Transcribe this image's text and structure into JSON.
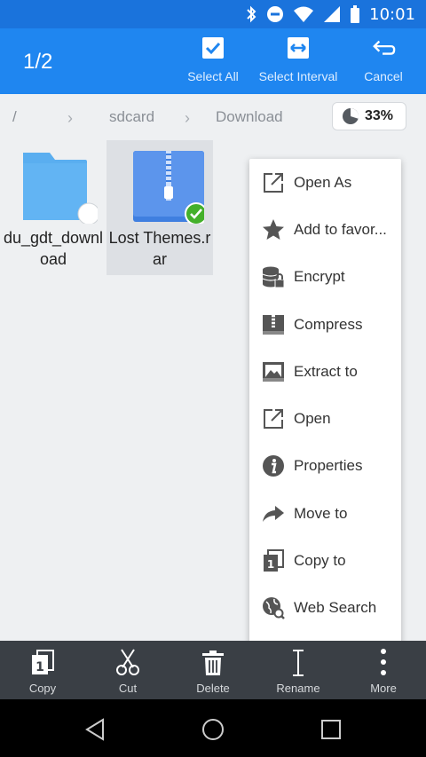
{
  "status_bar": {
    "time": "10:01"
  },
  "toolbar": {
    "selection_count": "1/2",
    "select_all_label": "Select All",
    "select_interval_label": "Select Interval",
    "cancel_label": "Cancel"
  },
  "breadcrumb": {
    "items": [
      "/",
      "sdcard",
      "Download"
    ],
    "storage_percent": "33%"
  },
  "files": [
    {
      "name": "du_gdt_download",
      "type": "folder-icon",
      "selected": false
    },
    {
      "name": "Lost Themes.rar",
      "type": "archive-icon",
      "selected": true
    }
  ],
  "context_menu": {
    "items": [
      {
        "label": "Open As",
        "icon": "open-external-icon"
      },
      {
        "label": "Add to favor...",
        "icon": "star-icon"
      },
      {
        "label": "Encrypt",
        "icon": "lock-database-icon"
      },
      {
        "label": "Compress",
        "icon": "compress-icon"
      },
      {
        "label": "Extract to",
        "icon": "extract-icon"
      },
      {
        "label": "Open",
        "icon": "open-external-icon"
      },
      {
        "label": "Properties",
        "icon": "info-icon"
      },
      {
        "label": "Move to",
        "icon": "share-arrow-icon"
      },
      {
        "label": "Copy to",
        "icon": "copy-icon"
      },
      {
        "label": "Web Search",
        "icon": "globe-search-icon"
      }
    ]
  },
  "bottom_bar": {
    "copy_label": "Copy",
    "cut_label": "Cut",
    "delete_label": "Delete",
    "rename_label": "Rename",
    "more_label": "More"
  },
  "colors": {
    "status_bar": "#1a73dc",
    "toolbar": "#1f86f0",
    "bottom_bar": "#3a3f45",
    "check_green": "#43b02a",
    "folder_blue": "#5aaef0",
    "archive_blue": "#3f7fe0"
  }
}
